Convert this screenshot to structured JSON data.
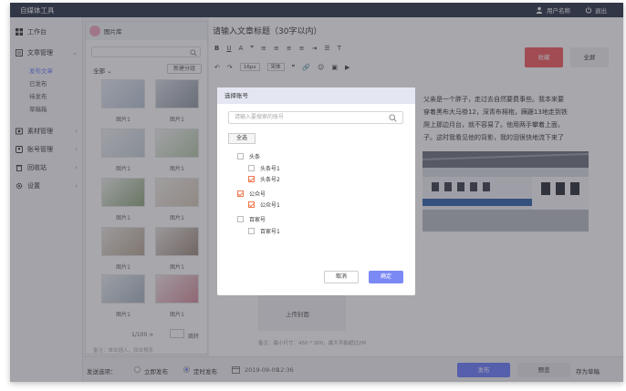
{
  "app": {
    "title": "自媒体工具"
  },
  "topbar": {
    "user_name": "用户名称",
    "logout": "退出"
  },
  "sidebar": {
    "items": [
      {
        "label": "工作台",
        "icon": "grid-icon"
      },
      {
        "label": "文章管理",
        "icon": "document-icon"
      },
      {
        "label": "素材管理",
        "icon": "media-icon"
      },
      {
        "label": "账号管理",
        "icon": "account-icon"
      },
      {
        "label": "回收站",
        "icon": "trash-icon"
      },
      {
        "label": "设置",
        "icon": "gear-icon"
      }
    ],
    "subitems": [
      "发布文章",
      "已发布",
      "待发布",
      "草稿箱"
    ],
    "active_sub": "发布文章"
  },
  "library": {
    "title": "图片库",
    "filter": "全部",
    "new_group": "新建分组",
    "thumb_label": "图片1",
    "pager": "1/100 >",
    "pager_go": "跳转",
    "note": "备注：单击插入，双击预览"
  },
  "editor": {
    "title_placeholder": "请输入文章标题（30字以内）",
    "font_size": "16px",
    "font_family": "宋体",
    "preview_button": "收藏",
    "fullscreen_button": "全屏",
    "paragraphs": [
      "父亲是一个胖子，走过去自然要费事些。我本来要",
      "穿着黑布大马褂12，深青布棉袍，蹒跚13地走到铁",
      "爬上那边月台，就不容易了。他用两手攀着上面，",
      "子。这时我看见他的背影，我的泪很快地流下来了"
    ],
    "cover_label": "上传封面",
    "cover_note": "备注：最小尺寸：450 * 300，最大不能超过2M"
  },
  "bottombar": {
    "send_options": "发送选项：",
    "publish_now": "立即发布",
    "scheduled": "定时发布",
    "date": "2019-09-09",
    "time": "12:36",
    "publish": "发布",
    "preview": "预览",
    "save_draft": "存为草稿"
  },
  "modal": {
    "title": "选择账号",
    "search_placeholder": "请输入要搜索的账号",
    "select_all": "全选",
    "groups": [
      {
        "name": "头条",
        "checked": false,
        "accounts": [
          {
            "name": "头条号1",
            "checked": false
          },
          {
            "name": "头条号2",
            "checked": true
          }
        ]
      },
      {
        "name": "公众号",
        "checked": true,
        "accounts": [
          {
            "name": "公众号1",
            "checked": true
          }
        ]
      },
      {
        "name": "百家号",
        "checked": false,
        "accounts": [
          {
            "name": "百家号1",
            "checked": false
          }
        ]
      }
    ],
    "cancel": "取消",
    "confirm": "确定"
  },
  "colors": {
    "accent": "#6b7cff",
    "topbar": "#2a3347",
    "danger": "#f2595b",
    "check": "#ee7a50"
  }
}
